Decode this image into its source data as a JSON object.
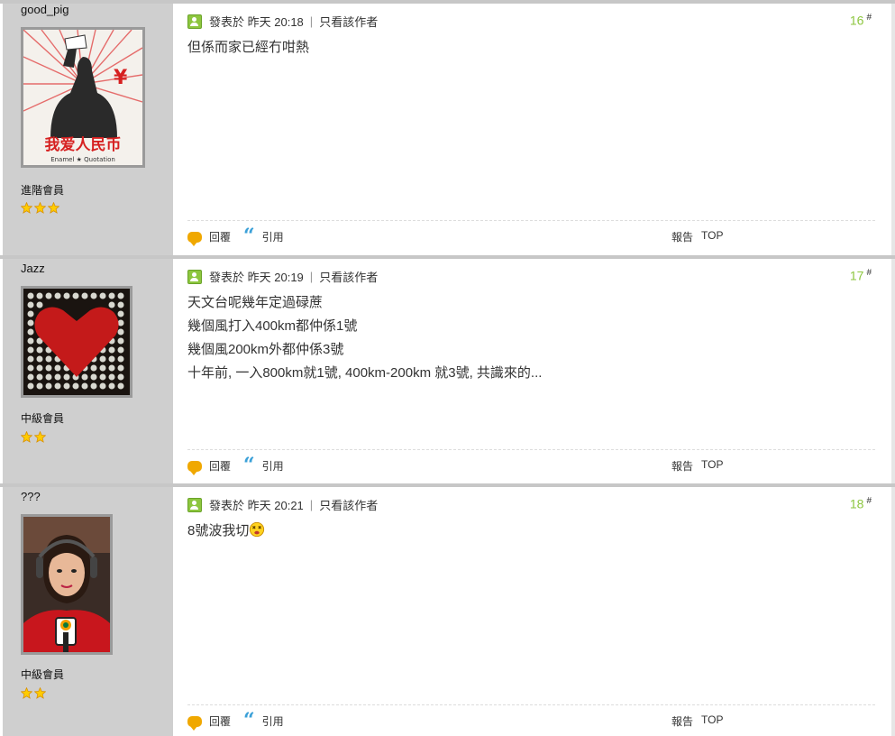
{
  "posts": [
    {
      "username": "good_pig",
      "rank": "進階會員",
      "stars": 3,
      "meta_prefix": "發表於",
      "time": "昨天 20:18",
      "only_author": "只看該作者",
      "floor": "16",
      "floor_mark": "#",
      "lines": [
        "但係而家已經冇咁熱"
      ],
      "avatar_icon": "poster-avatar",
      "avatar_text": "我爱人民币",
      "avatar_caption": "Enamel ★ Quotation"
    },
    {
      "username": "Jazz",
      "rank": "中級會員",
      "stars": 2,
      "meta_prefix": "發表於",
      "time": "昨天 20:19",
      "only_author": "只看該作者",
      "floor": "17",
      "floor_mark": "#",
      "lines": [
        "天文台呢幾年定過碌蔗",
        "幾個風打入400km都仲係1號",
        "幾個風200km外都仲係3號",
        "十年前, 一入800km就1號, 400km-200km 就3號, 共識來的..."
      ],
      "avatar_icon": "heart-avatar"
    },
    {
      "username": "???",
      "rank": "中級會員",
      "stars": 2,
      "meta_prefix": "發表於",
      "time": "昨天 20:21",
      "only_author": "只看該作者",
      "floor": "18",
      "floor_mark": "#",
      "lines": [
        "8號波我切"
      ],
      "emoji": "dizzy-emoji-icon",
      "avatar_icon": "reporter-avatar"
    }
  ],
  "actions": {
    "reply": "回覆",
    "quote": "引用",
    "report": "報告",
    "top": "TOP"
  },
  "colors": {
    "floor": "#8dc63f",
    "sidebar": "#cfcfcf",
    "reply_icon": "#f0a800",
    "quote_icon": "#3aa0d8"
  }
}
